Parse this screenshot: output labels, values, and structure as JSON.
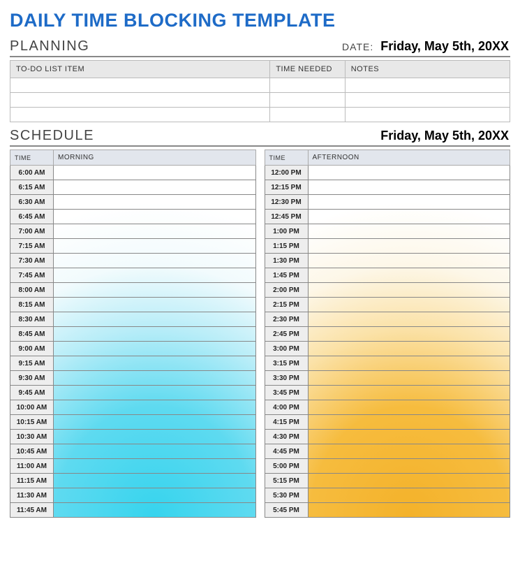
{
  "title": "DAILY TIME BLOCKING TEMPLATE",
  "planning": {
    "label": "PLANNING",
    "date_label": "DATE:",
    "date_value": "Friday, May 5th, 20XX",
    "columns": {
      "item": "TO-DO LIST ITEM",
      "time": "TIME NEEDED",
      "notes": "NOTES"
    },
    "rows": [
      {
        "item": "",
        "time": "",
        "notes": ""
      },
      {
        "item": "",
        "time": "",
        "notes": ""
      },
      {
        "item": "",
        "time": "",
        "notes": ""
      }
    ]
  },
  "schedule": {
    "label": "SCHEDULE",
    "date_value": "Friday, May 5th, 20XX",
    "morning": {
      "time_header": "TIME",
      "period_header": "MORNING",
      "slots": [
        "6:00 AM",
        "6:15 AM",
        "6:30 AM",
        "6:45 AM",
        "7:00 AM",
        "7:15 AM",
        "7:30 AM",
        "7:45 AM",
        "8:00 AM",
        "8:15 AM",
        "8:30 AM",
        "8:45 AM",
        "9:00 AM",
        "9:15 AM",
        "9:30 AM",
        "9:45 AM",
        "10:00 AM",
        "10:15 AM",
        "10:30 AM",
        "10:45 AM",
        "11:00 AM",
        "11:15 AM",
        "11:30 AM",
        "11:45 AM"
      ]
    },
    "afternoon": {
      "time_header": "TIME",
      "period_header": "AFTERNOON",
      "slots": [
        "12:00 PM",
        "12:15 PM",
        "12:30 PM",
        "12:45 PM",
        "1:00 PM",
        "1:15 PM",
        "1:30 PM",
        "1:45 PM",
        "2:00 PM",
        "2:15 PM",
        "2:30 PM",
        "2:45 PM",
        "3:00 PM",
        "3:15 PM",
        "3:30 PM",
        "3:45 PM",
        "4:00 PM",
        "4:15 PM",
        "4:30 PM",
        "4:45 PM",
        "5:00 PM",
        "5:15 PM",
        "5:30 PM",
        "5:45 PM"
      ]
    }
  }
}
